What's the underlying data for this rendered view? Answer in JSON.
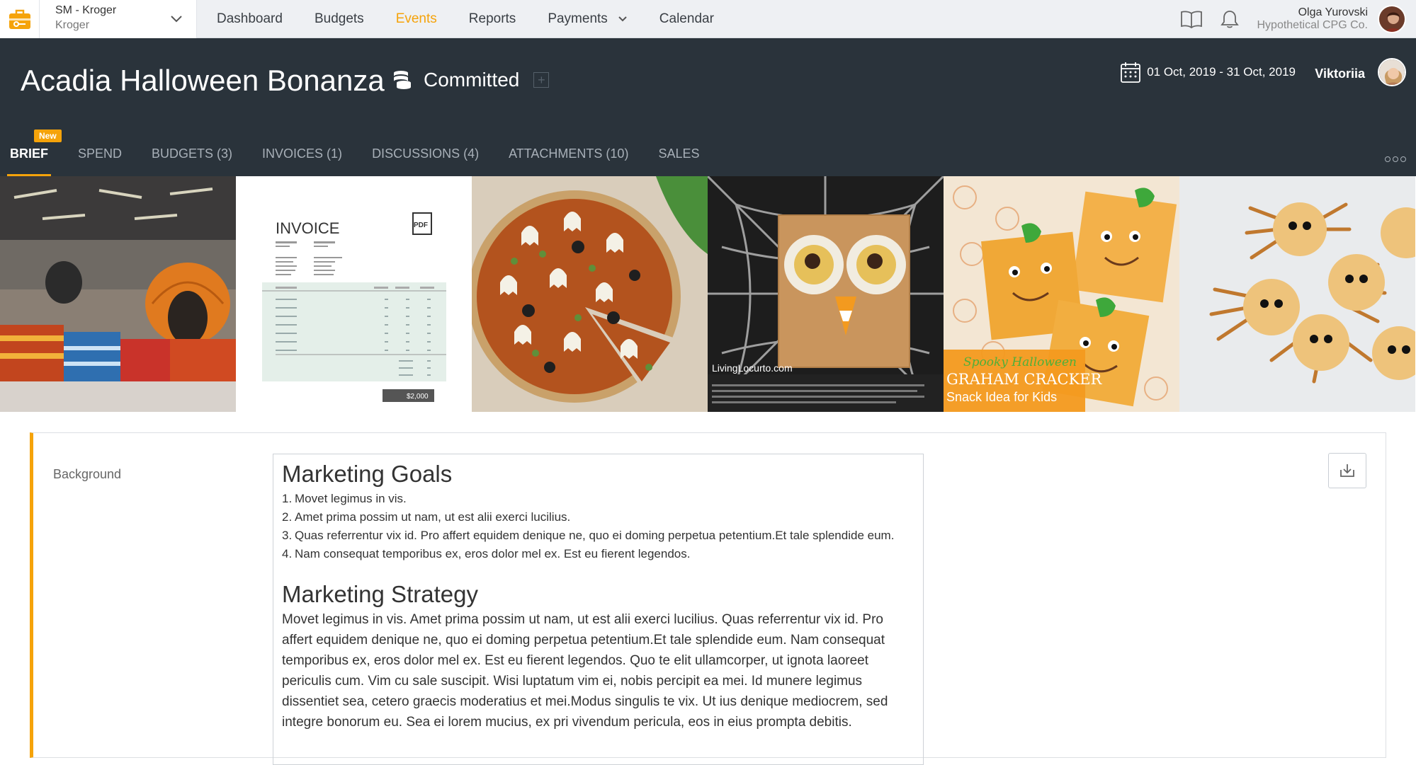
{
  "account": {
    "title": "SM - Kroger",
    "subtitle": "Kroger"
  },
  "nav": {
    "items": [
      {
        "label": "Dashboard"
      },
      {
        "label": "Budgets"
      },
      {
        "label": "Events"
      },
      {
        "label": "Reports"
      },
      {
        "label": "Payments"
      },
      {
        "label": "Calendar"
      }
    ],
    "active": "Events"
  },
  "user": {
    "name": "Olga Yurovski",
    "company": "Hypothetical CPG Co."
  },
  "event": {
    "title": "Acadia Halloween Bonanza",
    "status": "Committed",
    "status_add": "+",
    "dates": "01 Oct, 2019 - 31 Oct, 2019",
    "owner": "Viktoriia"
  },
  "tabs": [
    {
      "label": "BRIEF",
      "badge": "New"
    },
    {
      "label": "SPEND"
    },
    {
      "label": "BUDGETS (3)"
    },
    {
      "label": "INVOICES (1)"
    },
    {
      "label": "DISCUSSIONS (4)"
    },
    {
      "label": "ATTACHMENTS (10)"
    },
    {
      "label": "SALES"
    }
  ],
  "attachments": {
    "invoice": {
      "heading": "INVOICE",
      "badge": "PDF",
      "total": "$2,000"
    },
    "owl_caption": "LivingLocurto.com",
    "cracker_title": "Spooky Halloween",
    "cracker_line1": "GRAHAM CRACKER",
    "cracker_line2": "Snack Idea for Kids"
  },
  "brief": {
    "label": "Background",
    "goals_heading": "Marketing Goals",
    "goals": [
      {
        "num": "1.",
        "text": "Movet legimus in vis."
      },
      {
        "num": "2.",
        "text": "Amet prima possim ut nam, ut est alii exerci lucilius."
      },
      {
        "num": "3.",
        "text": "Quas referrentur vix id. Pro affert equidem denique ne, quo ei doming perpetua petentium.Et tale splendide eum."
      },
      {
        "num": "4.",
        "text": "Nam consequat temporibus ex, eros dolor mel ex. Est eu fierent legendos."
      }
    ],
    "strategy_heading": "Marketing Strategy",
    "strategy_text": "Movet legimus in vis. Amet prima possim ut nam, ut est alii exerci lucilius. Quas referrentur vix id. Pro affert equidem denique ne, quo ei doming perpetua petentium.Et tale splendide eum. Nam consequat temporibus ex, eros dolor mel ex. Est eu fierent legendos. Quo te elit ullamcorper, ut ignota laoreet periculis cum. Vim cu sale suscipit. Wisi luptatum vim ei, nobis percipit ea mei. Id munere legimus dissentiet sea, cetero graecis moderatius et mei.Modus singulis te vix. Ut ius denique mediocrem, sed integre bonorum eu. Sea ei lorem mucius, ex pri vivendum pericula, eos in eius prompta debitis."
  },
  "colors": {
    "accent": "#f5a30a",
    "header_bg": "#2a333b",
    "topbar_bg": "#eef0f3"
  },
  "icons": [
    "briefcase-icon",
    "chevron-down-icon",
    "book-icon",
    "bell-icon",
    "coins-icon",
    "calendar-icon",
    "download-icon",
    "more-icon"
  ]
}
